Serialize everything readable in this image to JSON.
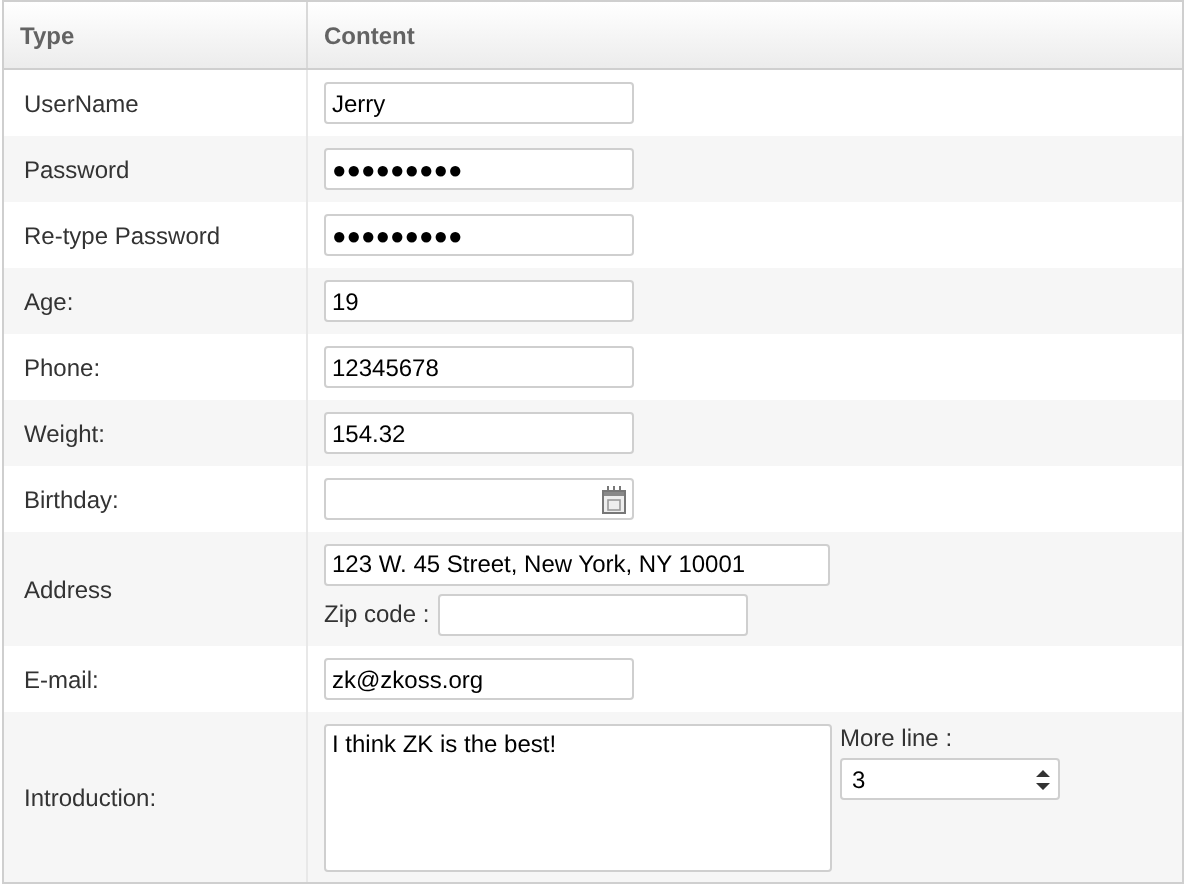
{
  "columns": [
    "Type",
    "Content"
  ],
  "rows": [
    {
      "label": "UserName",
      "kind": "text",
      "value": "Jerry"
    },
    {
      "label": "Password",
      "kind": "text",
      "value": "●●●●●●●●●"
    },
    {
      "label": "Re-type Password",
      "kind": "text",
      "value": "●●●●●●●●●"
    },
    {
      "label": "Age:",
      "kind": "text",
      "value": "19"
    },
    {
      "label": "Phone:",
      "kind": "text",
      "value": "12345678"
    },
    {
      "label": "Weight:",
      "kind": "text",
      "value": "154.32"
    },
    {
      "label": "Birthday:",
      "kind": "date"
    },
    {
      "label": "Address",
      "kind": "address",
      "value": "123 W. 45 Street, New York, NY 10001",
      "zip_label": "Zip code :"
    },
    {
      "label": "E-mail:",
      "kind": "text",
      "value": "zk@zkoss.org"
    },
    {
      "label": "Introduction:",
      "kind": "intro",
      "value": "I think ZK is the best!",
      "more_label": "More line :",
      "more_value": "3"
    }
  ]
}
